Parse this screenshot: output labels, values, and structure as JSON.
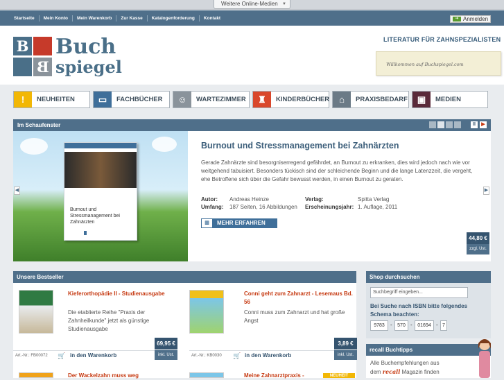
{
  "topbar": {
    "online_label": "Weitere Online-Medien"
  },
  "nav": {
    "links": [
      "Startseite",
      "Mein Konto",
      "Mein Warenkorb",
      "Zur Kasse",
      "Katalogenforderung",
      "Kontakt"
    ],
    "login_label": "Anmelden"
  },
  "logo": {
    "letter_b1": "B",
    "letter_b2": "B",
    "word1": "Buch",
    "word2": "spiegel"
  },
  "header": {
    "tagline": "LITERATUR FÜR ZAHNSPEZIALISTEN",
    "welcome": "Willkommen auf Buchspiegel.com"
  },
  "categories": [
    {
      "label": "NEUHEITEN",
      "icon": "exclamation-icon",
      "color": "#f2b705",
      "glyph": "!"
    },
    {
      "label": "FACHBÜCHER",
      "icon": "book-icon",
      "color": "#3f6f9a",
      "glyph": "▭"
    },
    {
      "label": "WARTEZIMMER",
      "icon": "chair-icon",
      "color": "#8a939b",
      "glyph": "☺"
    },
    {
      "label": "KINDERBÜCHER",
      "icon": "teddy-icon",
      "color": "#d9472b",
      "glyph": "♜"
    },
    {
      "label": "PRAXISBEDARF",
      "icon": "house-icon",
      "color": "#6b7a86",
      "glyph": "⌂"
    },
    {
      "label": "MEDIEN",
      "icon": "monitor-icon",
      "color": "#5a2a3a",
      "glyph": "▣"
    }
  ],
  "showcase": {
    "section_title": "Im Schaufenster",
    "title": "Burnout und Stressmanagement bei Zahnärzten",
    "description": "Gerade Zahnärzte sind besorgniserregend gefährdet, an Burnout zu erkranken, dies wird jedoch nach wie vor weitgehend tabuisiert. Besonders tückisch sind der schleichende Beginn und die lange Latenzzeit, die vergeht, ehe Betroffene sich über die Gefahr bewusst werden, in einen Burnout zu geraten.",
    "autor_label": "Autor:",
    "autor": "Andreas Heinze",
    "verlag_label": "Verlag:",
    "verlag": "Spitta Verlag",
    "umfang_label": "Umfang:",
    "umfang": "187 Seiten, 16 Abbildungen",
    "jahr_label": "Erscheinungsjahr:",
    "jahr": "1. Auflage, 2011",
    "more_label": "MEHR ERFAHREN",
    "price": "44,80 €",
    "price_note": "zzgl. Ust.",
    "book_cover_text": "Burnout und Stressmanagement bei Zahnärzten",
    "pause": "II",
    "play": "▶"
  },
  "bestseller": {
    "title": "Unsere Bestseller",
    "items": [
      {
        "title": "Kieferorthopädie II - Studienausgabe",
        "desc": "Die etablierte Reihe \"Praxis der Zahnheilkunde\" jetzt als günstige Studienausgabe",
        "artnr": "Art.-Nr.: FB00072",
        "cart": "in den Warenkorb",
        "price": "69,95 €",
        "price_note": "inkl. Ust."
      },
      {
        "title": "Conni geht zum Zahnarzt - Lesemaus Bd. 56",
        "desc": "Conni muss zum Zahnarzt und hat große Angst",
        "artnr": "Art.-Nr.: KB0030",
        "cart": "in den Warenkorb",
        "price": "3,89 €",
        "price_note": "inkl. Ust."
      },
      {
        "title": "Der Wackelzahn muss weg"
      },
      {
        "title": "Meine Zahnarztpraxis -",
        "badge": "NEUHEIT"
      }
    ]
  },
  "shop": {
    "title": "Shop durchsuchen",
    "search_placeholder": "Suchbegriff eingeben...",
    "isbn_label": "Bei Suche nach ISBN bitte folgendes Schema beachten:",
    "isbn_parts": [
      "9783",
      "570",
      "01694",
      "7"
    ],
    "sep": "-"
  },
  "recall": {
    "title": "recall Buchtipps",
    "text1": "Alle Buchempfehlungen aus",
    "text2_pre": "dem",
    "brand": "recall",
    "text2_post": "Magazin finden"
  }
}
